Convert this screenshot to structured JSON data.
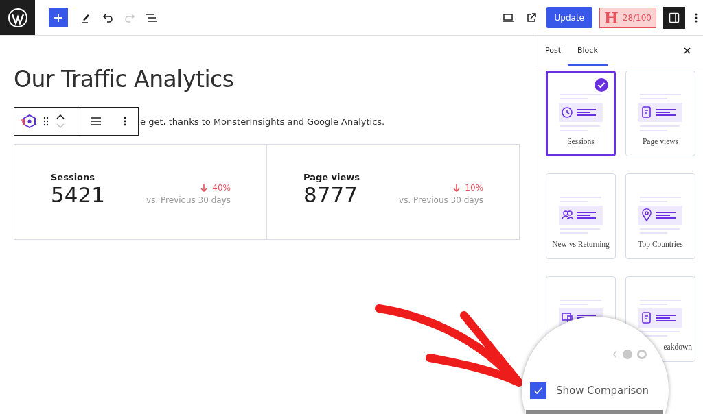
{
  "topbar": {
    "tools": [
      {
        "kind": "add",
        "disabled": false
      },
      {
        "kind": "pencil",
        "disabled": false
      },
      {
        "kind": "undo",
        "disabled": false
      },
      {
        "kind": "redo",
        "disabled": true
      },
      {
        "kind": "list",
        "disabled": false
      }
    ],
    "update": "Update",
    "score": {
      "letter": "H",
      "value": "28/100"
    },
    "settings_on": true
  },
  "editor": {
    "title": "Our Traffic Analytics",
    "paragraph": "e get, thanks to MonsterInsights and Google Analytics.",
    "stats": [
      {
        "label": "Sessions",
        "value": "5421",
        "change": "-40%",
        "compare": "vs. Previous 30 days"
      },
      {
        "label": "Page views",
        "value": "8777",
        "change": "-10%",
        "compare": "vs. Previous 30 days"
      }
    ]
  },
  "sidebar": {
    "tabs": [
      {
        "label": "Post",
        "selected": false
      },
      {
        "label": "Block",
        "selected": true
      }
    ],
    "cards": [
      {
        "kind": "clock",
        "label": "Sessions",
        "selected": true
      },
      {
        "kind": "doc",
        "label": "Page views",
        "selected": false
      },
      {
        "kind": "users",
        "label": "New vs Returning",
        "selected": false
      },
      {
        "kind": "pin",
        "label": "Top Countries",
        "selected": false
      },
      {
        "kind": "device",
        "selected": false
      },
      {
        "kind": "doc",
        "label": "eakdown",
        "selected": false
      }
    ]
  },
  "magnifier": {
    "checked": true,
    "label": "Show Comparison"
  }
}
